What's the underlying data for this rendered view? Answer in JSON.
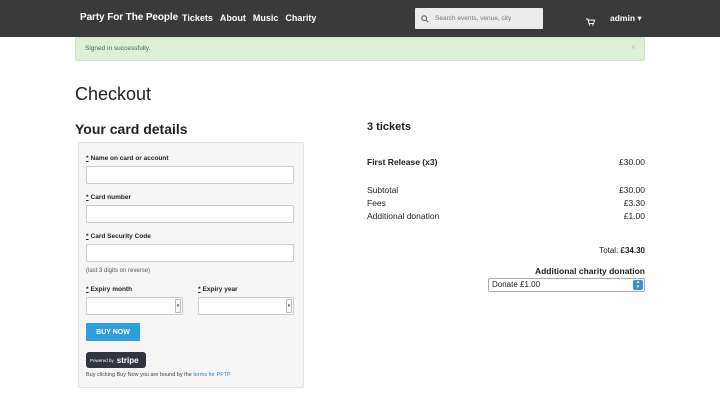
{
  "navbar": {
    "brand": "Party For The People",
    "links": [
      "Tickets",
      "About",
      "Music",
      "Charity"
    ],
    "search_placeholder": "Search events, venue, city",
    "user": "admin ▾"
  },
  "alert": {
    "message": "Signed in successfully.",
    "close": "×"
  },
  "page_title": "Checkout",
  "card_details": {
    "title": "Your card details",
    "name_label": "Name on card or account",
    "number_label": "Card number",
    "cvc_label": "Card Security Code",
    "cvc_hint": "(last 3 digits on reverse)",
    "expiry_month_label": "Expiry month",
    "expiry_year_label": "Expiry year",
    "required_mark": "*",
    "buy_button": "BUY NOW",
    "stripe_small": "Powered by",
    "stripe_big": "stripe",
    "terms_text": "Buy clicking Buy Now you are bound by the ",
    "terms_link": "terms for PFTP"
  },
  "summary": {
    "title": "3 tickets",
    "line_item": {
      "label": "First Release (x3)",
      "value": "£30.00"
    },
    "subtotal": {
      "label": "Subtotal",
      "value": "£30.00"
    },
    "fees": {
      "label": "Fees",
      "value": "£3.30"
    },
    "donation": {
      "label": "Additional donation",
      "value": "£1.00"
    },
    "total_label": "Total: ",
    "total_value": "£34.30",
    "charity_title": "Additional charity donation",
    "charity_selected": "Donate £1.00"
  },
  "colors": {
    "navbar": "#3a3a3a",
    "alert_bg": "#dff0d8",
    "buy_button": "#2d9fdc",
    "link": "#3b7dc4"
  }
}
